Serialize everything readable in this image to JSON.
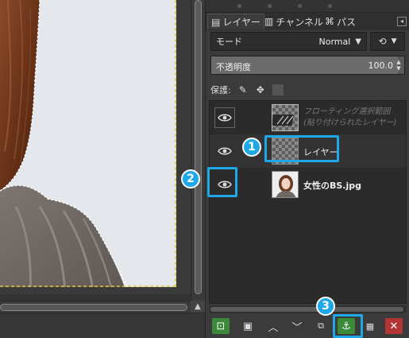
{
  "tabs": [
    {
      "label": "レイヤー",
      "icon": "layers-icon",
      "active": true
    },
    {
      "label": "チャンネル",
      "icon": "channels-icon",
      "active": false
    },
    {
      "label": "パス",
      "icon": "paths-icon",
      "active": false
    }
  ],
  "mode": {
    "label": "モード",
    "value": "Normal"
  },
  "opacity": {
    "label": "不透明度",
    "value": "100.0"
  },
  "lock": {
    "label": "保護:"
  },
  "layers": [
    {
      "name_line1": "フローティング選択範囲",
      "name_line2": "(貼り付けられたレイヤー)",
      "visible": true
    },
    {
      "name": "レイヤー",
      "visible": true,
      "selected": true
    },
    {
      "name": "女性のBS.jpg",
      "visible": true
    }
  ],
  "annotations": [
    "1",
    "2",
    "3"
  ],
  "colors": {
    "highlight": "#1fa8e8",
    "anchor_button": "#3a8a3a",
    "delete_button": "#b33636",
    "panel_bg": "#3b3b3b"
  }
}
